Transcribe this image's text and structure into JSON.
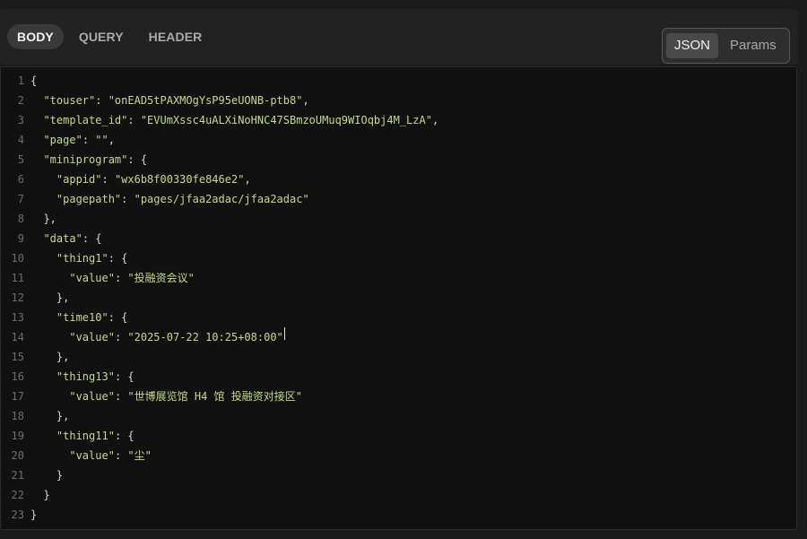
{
  "tabs": [
    {
      "label": "BODY",
      "active": true
    },
    {
      "label": "QUERY",
      "active": false
    },
    {
      "label": "HEADER",
      "active": false
    }
  ],
  "mode_toggle": [
    {
      "label": "JSON",
      "active": true
    },
    {
      "label": "Params",
      "active": false
    }
  ],
  "editor": {
    "line_numbers": [
      "1",
      "2",
      "3",
      "4",
      "5",
      "6",
      "7",
      "8",
      "9",
      "10",
      "11",
      "12",
      "13",
      "14",
      "15",
      "16",
      "17",
      "18",
      "19",
      "20",
      "21",
      "22",
      "23"
    ],
    "lines": [
      "{",
      "  \"touser\": \"onEAD5tPAXMOgYsP95eUONB-ptb8\",",
      "  \"template_id\": \"EVUmXssc4uALXiNoHNC47SBmzoUMuq9WIOqbj4M_LzA\",",
      "  \"page\": \"\",",
      "  \"miniprogram\": {",
      "    \"appid\": \"wx6b8f00330fe846e2\",",
      "    \"pagepath\": \"pages/jfaa2adac/jfaa2adac\"",
      "  },",
      "  \"data\": {",
      "    \"thing1\": {",
      "      \"value\": \"投融资会议\"",
      "    },",
      "    \"time10\": {",
      "      \"value\": \"2025-07-22 10:25+08:00\"",
      "    },",
      "    \"thing13\": {",
      "      \"value\": \"世博展览馆 H4 馆 投融资对接区\"",
      "    },",
      "    \"thing11\": {",
      "      \"value\": \"尘\"",
      "    }",
      "  }",
      "}"
    ],
    "cursor_line": 14
  },
  "colors": {
    "background": "#1b1b1b",
    "editor_background": "#111111",
    "string": "#c6d98a",
    "punctuation": "#d7d7d7",
    "line_number": "#6c6c6c"
  }
}
